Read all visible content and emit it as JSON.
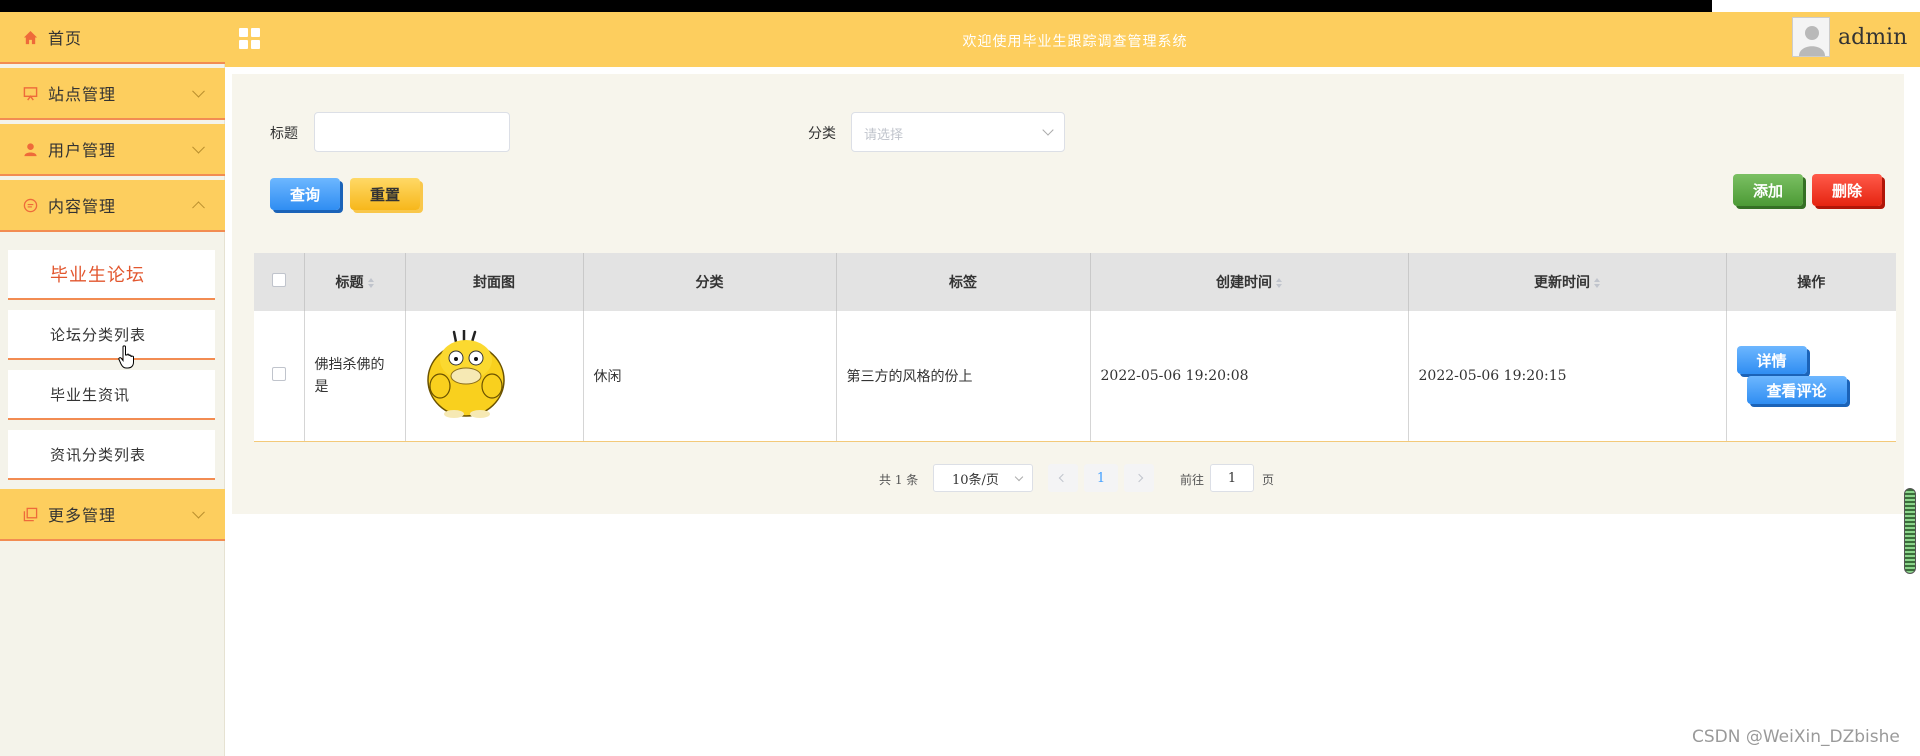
{
  "header": {
    "title": "欢迎使用毕业生跟踪调查管理系统",
    "username": "admin"
  },
  "sidebar": {
    "items": [
      {
        "label": "首页",
        "icon": "home-icon"
      },
      {
        "label": "站点管理",
        "icon": "monitor-icon"
      },
      {
        "label": "用户管理",
        "icon": "user-icon"
      },
      {
        "label": "内容管理",
        "icon": "chat-icon"
      },
      {
        "label": "更多管理",
        "icon": "copy-icon"
      }
    ],
    "subitems": [
      "毕业生论坛",
      "论坛分类列表",
      "毕业生资讯",
      "资讯分类列表"
    ]
  },
  "search": {
    "title_label": "标题",
    "category_label": "分类",
    "category_placeholder": "请选择",
    "query_button": "查询",
    "reset_button": "重置",
    "add_button": "添加",
    "delete_button": "删除"
  },
  "table": {
    "columns": [
      "标题",
      "封面图",
      "分类",
      "标签",
      "创建时间",
      "更新时间",
      "操作"
    ],
    "rows": [
      {
        "title": "佛挡杀佛的是",
        "category": "休闲",
        "tags": "第三方的风格的份上",
        "created": "2022-05-06 19:20:08",
        "updated": "2022-05-06 19:20:15",
        "detail_button": "详情",
        "comment_button": "查看评论"
      }
    ]
  },
  "pagination": {
    "total": "共 1 条",
    "page_size": "10条/页",
    "current_page": "1",
    "goto_label": "前往",
    "goto_value": "1",
    "page_suffix": "页"
  },
  "watermark": "CSDN @WeiXin_DZbishe",
  "colors": {
    "header_bg": "#fdce5e",
    "active_menu_text": "#e2572f",
    "divider": "#f28c52"
  }
}
